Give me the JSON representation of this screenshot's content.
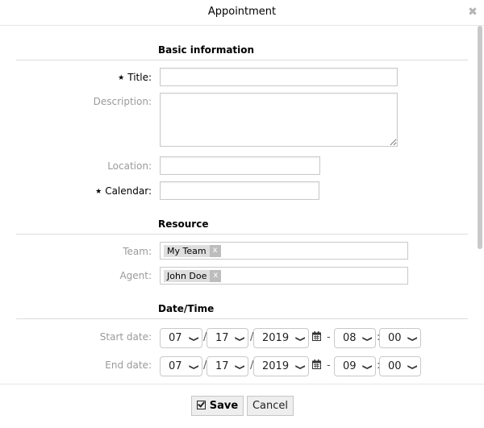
{
  "dialog": {
    "title": "Appointment",
    "close_icon": "close-icon"
  },
  "sections": {
    "basic": "Basic information",
    "resource": "Resource",
    "datetime": "Date/Time"
  },
  "fields": {
    "title": {
      "label": "Title:",
      "required": true,
      "value": ""
    },
    "description": {
      "label": "Description:",
      "required": false,
      "value": ""
    },
    "location": {
      "label": "Location:",
      "required": false,
      "value": ""
    },
    "calendar": {
      "label": "Calendar:",
      "required": true,
      "value": ""
    },
    "team": {
      "label": "Team:",
      "tags": [
        "My Team"
      ]
    },
    "agent": {
      "label": "Agent:",
      "tags": [
        "John Doe"
      ]
    },
    "required_marker": "★",
    "tag_remove": "x"
  },
  "dates": {
    "start": {
      "label": "Start date:",
      "month": "07",
      "day": "17",
      "year": "2019",
      "hour": "08",
      "minute": "00"
    },
    "end": {
      "label": "End date:",
      "month": "07",
      "day": "17",
      "year": "2019",
      "hour": "09",
      "minute": "00"
    },
    "date_sep": "/",
    "range_sep": "-",
    "time_sep": ":"
  },
  "buttons": {
    "save": "Save",
    "cancel": "Cancel"
  }
}
